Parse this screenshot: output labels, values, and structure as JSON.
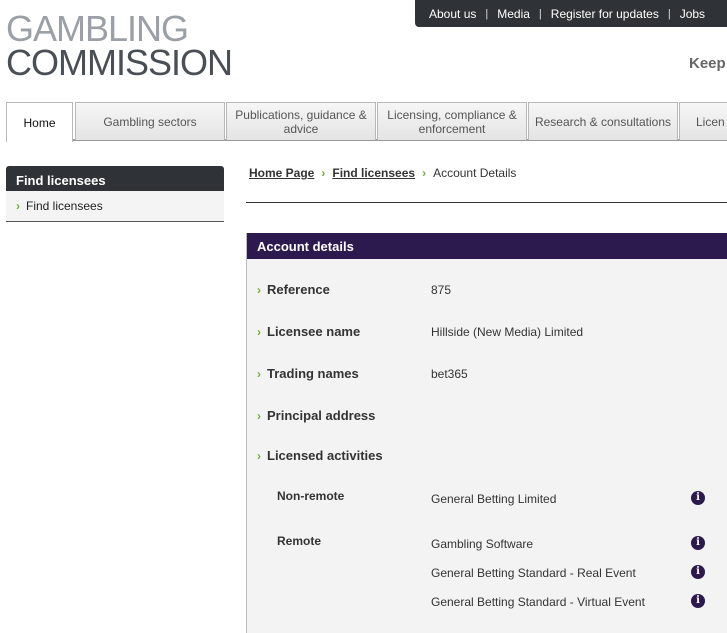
{
  "logo": {
    "line1": "GAMBLING",
    "line2": "COMMISSION"
  },
  "utility_nav": [
    "About us",
    "Media",
    "Register for updates",
    "Jobs"
  ],
  "tagline": "Keep",
  "main_nav": [
    {
      "label": "Home"
    },
    {
      "label": "Gambling sectors"
    },
    {
      "label": "Publications, guidance & advice"
    },
    {
      "label": "Licensing, compliance & enforcement"
    },
    {
      "label": "Research & consultations"
    },
    {
      "label": "Licen"
    }
  ],
  "sidebar": {
    "title": "Find licensees",
    "items": [
      {
        "label": "Find licensees"
      }
    ]
  },
  "breadcrumb": {
    "home": "Home Page",
    "find": "Find licensees",
    "current": "Account Details"
  },
  "panel": {
    "title": "Account details",
    "reference_label": "Reference",
    "reference_value": "875",
    "licensee_label": "Licensee name",
    "licensee_value": "Hillside (New Media) Limited",
    "trading_label": "Trading names",
    "trading_value": "bet365",
    "address_label": "Principal address",
    "activities_label": "Licensed activities",
    "nonremote_label": "Non-remote",
    "nonremote_items": [
      "General Betting Limited"
    ],
    "remote_label": "Remote",
    "remote_items": [
      "Gambling Software",
      "General Betting Standard - Real Event",
      "General Betting Standard - Virtual Event"
    ]
  },
  "icons": {
    "info": "info-icon",
    "chevron": "chevron-right-icon"
  },
  "colors": {
    "panel_header": "#2c1a4e",
    "accent": "#6cb13a",
    "dark_nav": "#2f3337"
  }
}
